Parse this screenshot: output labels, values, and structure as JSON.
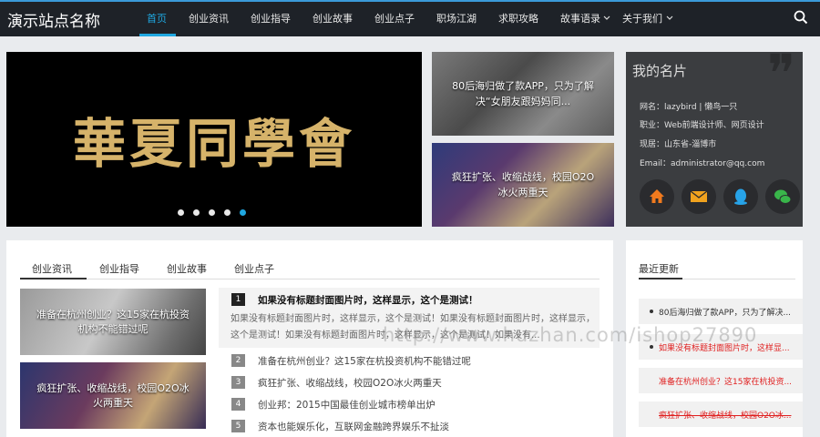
{
  "header": {
    "site_name": "演示站点名称",
    "nav": [
      {
        "label": "首页"
      },
      {
        "label": "创业资讯"
      },
      {
        "label": "创业指导"
      },
      {
        "label": "创业故事"
      },
      {
        "label": "创业点子"
      },
      {
        "label": "职场江湖"
      },
      {
        "label": "求职攻略"
      },
      {
        "label": "故事语录"
      },
      {
        "label": "关于我们"
      }
    ],
    "active_color": "#1fa7e0"
  },
  "hero": {
    "text": "華夏同學會",
    "dots_count": 5,
    "active_dot": 5
  },
  "side_slides": [
    {
      "caption": "80后海归做了款APP，只为了解决“女朋友跟妈妈同..."
    },
    {
      "caption": "疯狂扩张、收缩战线，校园O2O冰火两重天"
    }
  ],
  "card": {
    "title": "我的名片",
    "lines": [
      "网名：lazybird | 懒鸟一只",
      "职业：Web前端设计师、网页设计",
      "现居：山东省-淄博市",
      "Email：administrator@qq.com"
    ],
    "icons": [
      "home-icon",
      "mail-icon",
      "qq-icon",
      "wechat-icon"
    ]
  },
  "tabs": [
    "创业资讯",
    "创业指导",
    "创业故事",
    "创业点子"
  ],
  "pics": [
    {
      "caption": "准备在杭州创业？这15家在杭投资机构不能错过呢"
    },
    {
      "caption": "疯狂扩张、收缩战线，校园O2O冰火两重天"
    }
  ],
  "feature": {
    "num": "1",
    "title": "如果没有标题封面图片时，这样显示，这个是测试！",
    "desc": "如果没有标题封面图片时，这样显示，这个是测试！如果没有标题封面图片时，这样显示，这个是测试！如果没有标题封面图片时，这样显示，这个是测试！如果没有..."
  },
  "list": [
    {
      "num": "2",
      "title": "准备在杭州创业？这15家在杭投资机构不能错过呢"
    },
    {
      "num": "3",
      "title": "疯狂扩张、收缩战线，校园O2O冰火两重天"
    },
    {
      "num": "4",
      "title": "创业邦：2015中国最佳创业城市榜单出炉"
    },
    {
      "num": "5",
      "title": "资本也能娱乐化，互联网金融跨界娱乐不扯淡"
    }
  ],
  "recent": {
    "title": "最近更新",
    "items": [
      {
        "text": "80后海归做了款APP，只为了解决...",
        "style": "normal"
      },
      {
        "text": "如果没有标题封面图片时，这样显...",
        "style": "red"
      },
      {
        "text": "准备在杭州创业？这15家在杭投资...",
        "style": "red"
      },
      {
        "text": "疯狂扩张、收缩战线，校园O2O冰...",
        "style": "red-strike"
      }
    ]
  },
  "watermark": "http://www.huzhan.com/ishop27890"
}
